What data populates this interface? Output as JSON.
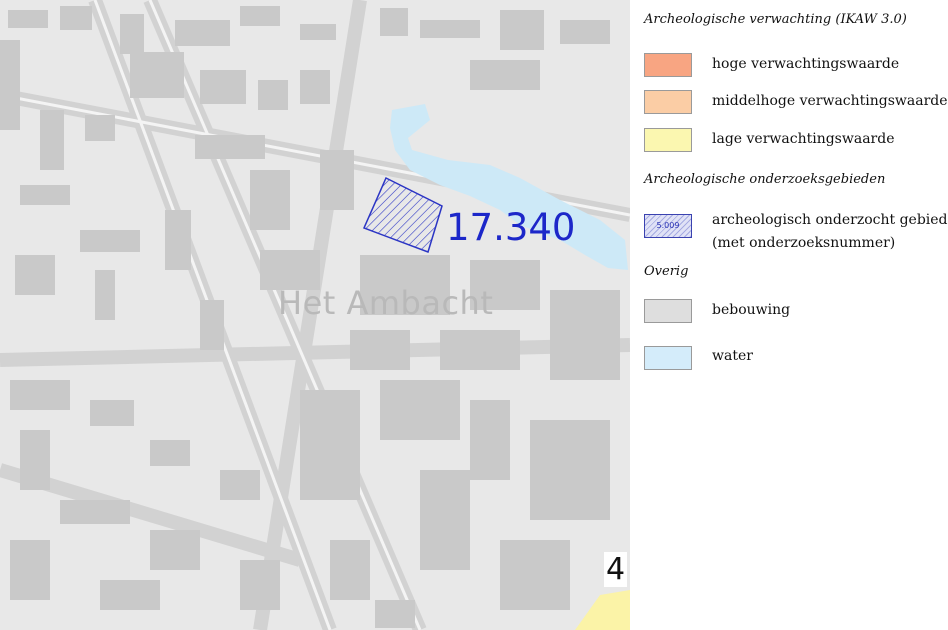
{
  "map": {
    "area_label": "Het Ambacht",
    "study_number": "17.340",
    "edge_number": "4",
    "colors": {
      "background": "#e8e8e8",
      "building": "#c8c8c8",
      "street_line": "#d4d4d4",
      "water": "#cde9f7",
      "hatch": "#2b35c4",
      "low_expectation": "#fbf3a7"
    }
  },
  "legend": {
    "heading_expectation": "Archeologische verwachting (IKAW 3.0)",
    "items_expectation": [
      {
        "label": "hoge verwachtingswaarde",
        "color": "#f8a582"
      },
      {
        "label": "middelhoge verwachtingswaarde",
        "color": "#fbcda5"
      },
      {
        "label": "lage verwachtingswaarde",
        "color": "#fbf7b0"
      }
    ],
    "heading_research": "Archeologische onderzoeksgebieden",
    "research_item": {
      "line1": "archeologisch onderzocht gebied",
      "line2": "(met onderzoeksnummer)",
      "swatch_text": "5.009"
    },
    "heading_other": "Overig",
    "items_other": [
      {
        "label": "bebouwing",
        "color": "#dedede"
      },
      {
        "label": "water",
        "color": "#d4ecfa"
      }
    ]
  }
}
